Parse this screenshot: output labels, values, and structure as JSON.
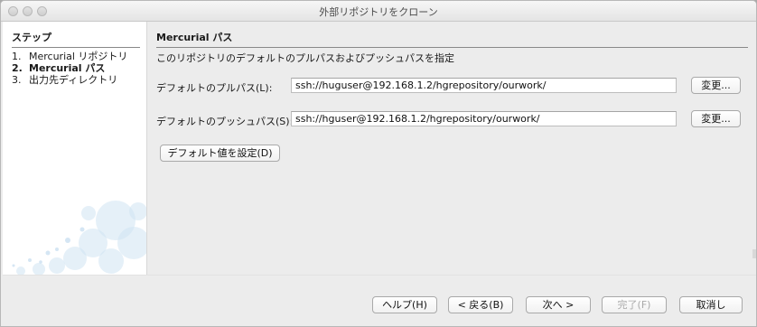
{
  "window": {
    "title": "外部リポジトリをクローン"
  },
  "steps": {
    "header": "ステップ",
    "items": [
      {
        "num": "1.",
        "label": "Mercurial リポジトリ",
        "current": false
      },
      {
        "num": "2.",
        "label": "Mercurial パス",
        "current": true
      },
      {
        "num": "3.",
        "label": "出力先ディレクトリ",
        "current": false
      }
    ]
  },
  "main": {
    "section_title": "Mercurial パス",
    "description": "このリポジトリのデフォルトのプルパスおよびプッシュパスを指定",
    "pull": {
      "label": "デフォルトのプルパス(L):",
      "value": "ssh://huguser@192.168.1.2/hgrepository/ourwork/",
      "change_label": "変更..."
    },
    "push": {
      "label": "デフォルトのプッシュパス(S):",
      "value": "ssh://hguser@192.168.1.2/hgrepository/ourwork/",
      "change_label": "変更..."
    },
    "set_default_label": "デフォルト値を設定(D)"
  },
  "footer": {
    "help": "ヘルプ(H)",
    "back": "< 戻る(B)",
    "next": "次へ >",
    "finish": "完了(F)",
    "cancel": "取消し"
  }
}
